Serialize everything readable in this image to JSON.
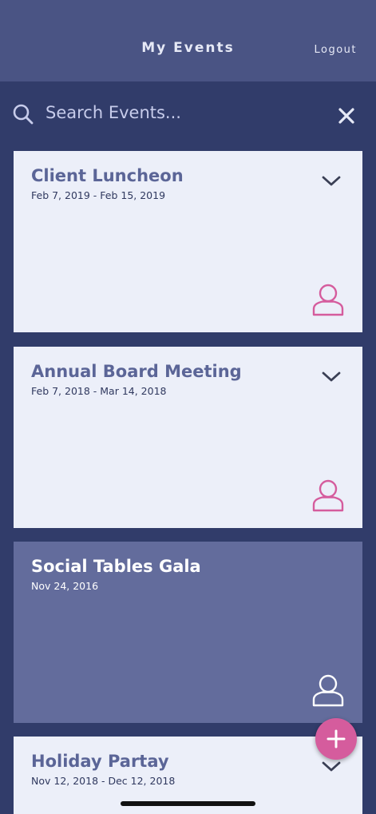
{
  "header": {
    "title": "My Events",
    "logout_label": "Logout"
  },
  "search": {
    "placeholder": "Search Events..."
  },
  "events": [
    {
      "title": "Client Luncheon",
      "dates": "Feb 7, 2019 - Feb 15, 2019",
      "expandable": true,
      "selected": false
    },
    {
      "title": "Annual Board Meeting",
      "dates": "Feb 7, 2018 - Mar 14, 2018",
      "expandable": true,
      "selected": false
    },
    {
      "title": "Social Tables Gala",
      "dates": "Nov 24, 2016",
      "expandable": false,
      "selected": true
    },
    {
      "title": "Holiday Partay",
      "dates": "Nov 12, 2018 - Dec 12, 2018",
      "expandable": true,
      "selected": false
    }
  ],
  "colors": {
    "header_bg": "#4a5484",
    "page_bg": "#313c6a",
    "card_bg": "#eceff9",
    "card_selected_bg": "#636c9c",
    "accent_pink": "#d55c9d",
    "title_color": "#5b6597"
  },
  "icons": {
    "search": "search-icon",
    "clear": "close-icon",
    "expand": "chevron-down-icon",
    "owner": "person-icon",
    "add": "plus-icon"
  }
}
